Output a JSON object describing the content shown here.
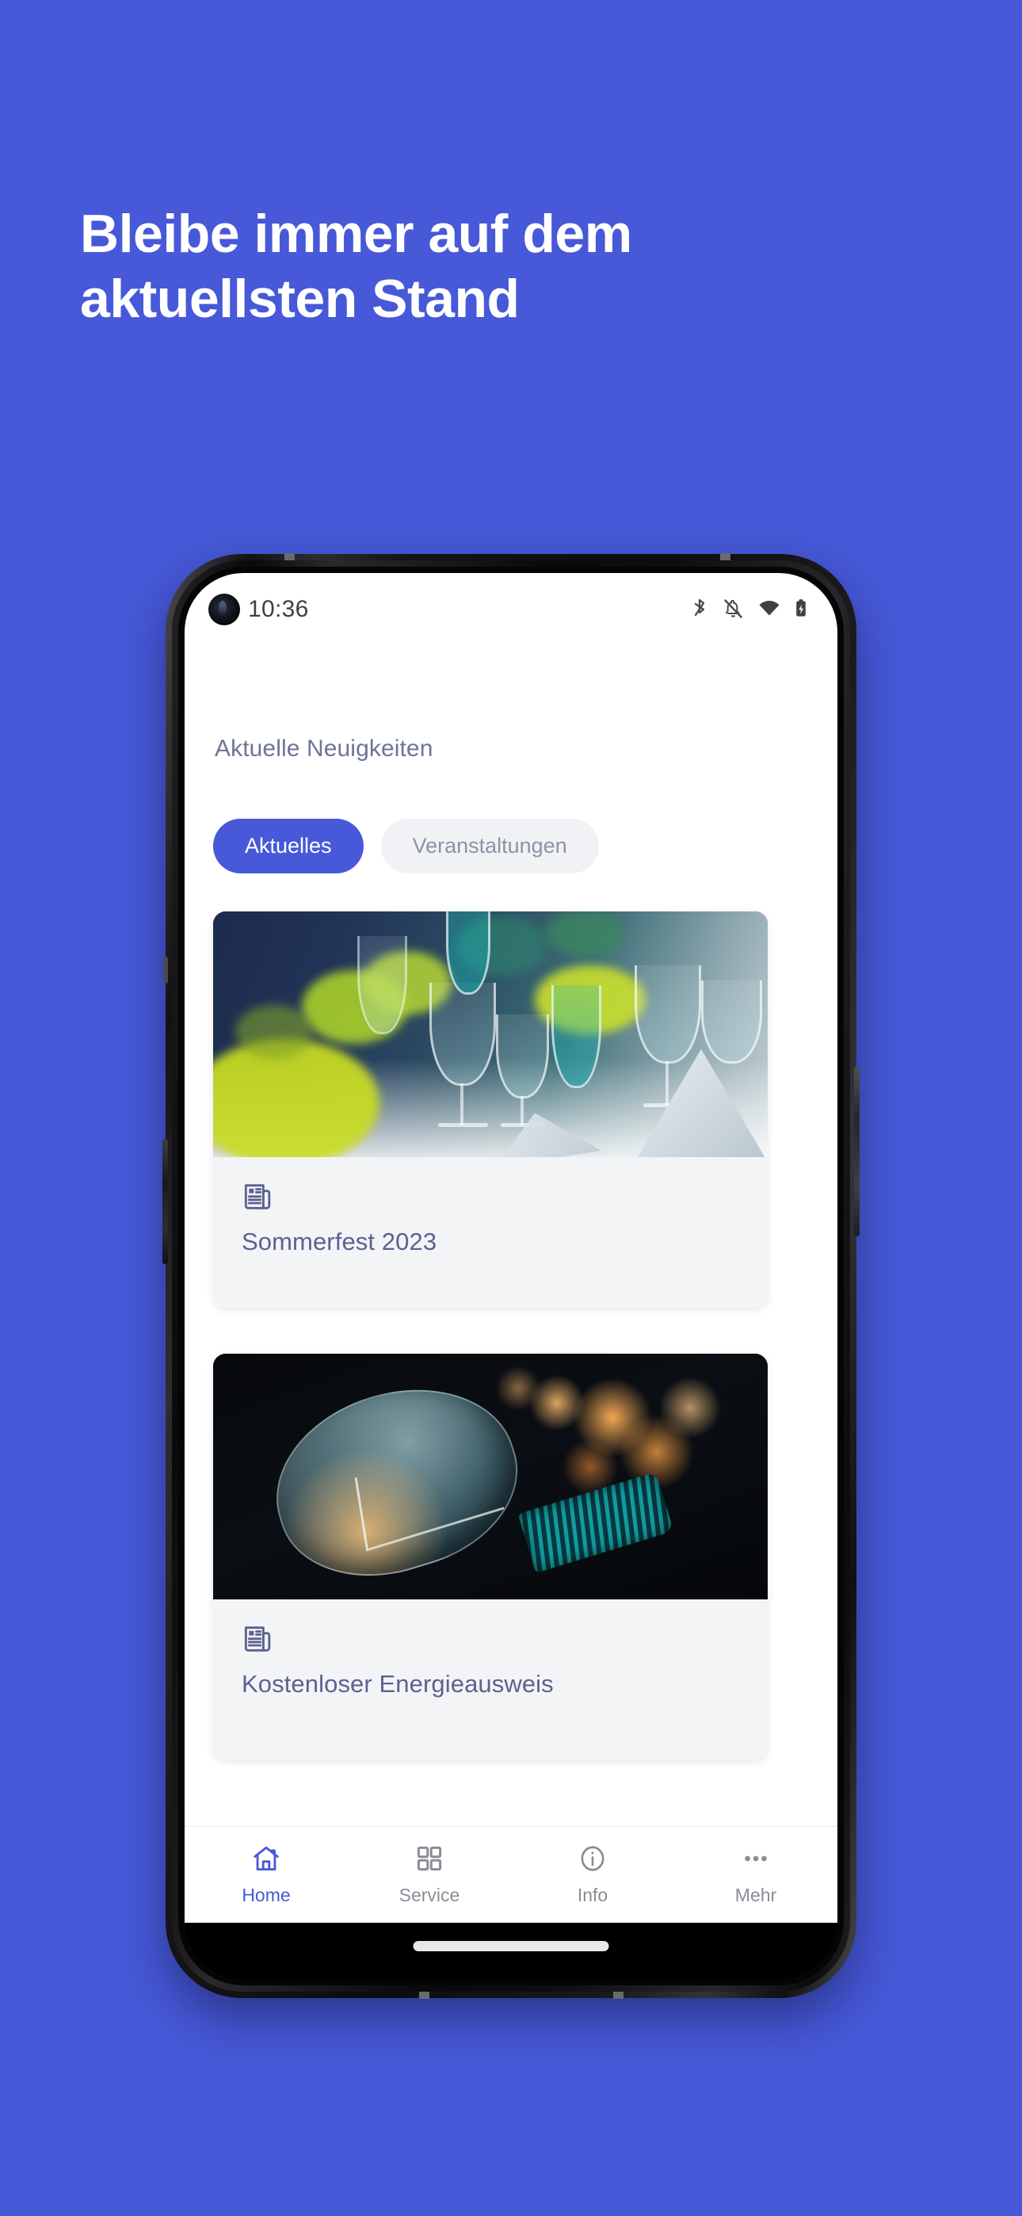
{
  "promo": {
    "headline": "Bleibe immer auf dem\naktuellsten Stand",
    "background_color": "#4759d8"
  },
  "phone": {
    "status_bar": {
      "time": "10:36",
      "icons": [
        "bluetooth-icon",
        "notifications-muted-icon",
        "wifi-icon",
        "battery-charging-icon"
      ]
    },
    "gesture_bar": "home-gesture-indicator"
  },
  "app": {
    "section_title": "Aktuelle Neuigkeiten",
    "accent_color": "#4759d8",
    "tabs": [
      {
        "label": "Aktuelles",
        "active": true
      },
      {
        "label": "Veranstaltungen",
        "active": false
      }
    ],
    "cards": [
      {
        "title": "Sommerfest 2023",
        "icon": "newspaper-icon",
        "image_alt": "festive-table-setting-with-glasses"
      },
      {
        "title": "Kostenloser Energieausweis",
        "icon": "newspaper-icon",
        "image_alt": "vintage-light-bulb-with-bokeh"
      }
    ],
    "bottom_nav": [
      {
        "label": "Home",
        "icon": "home-icon",
        "active": true
      },
      {
        "label": "Service",
        "icon": "grid-icon",
        "active": false
      },
      {
        "label": "Info",
        "icon": "info-circle-icon",
        "active": false
      },
      {
        "label": "Mehr",
        "icon": "more-dots-icon",
        "active": false
      }
    ]
  }
}
